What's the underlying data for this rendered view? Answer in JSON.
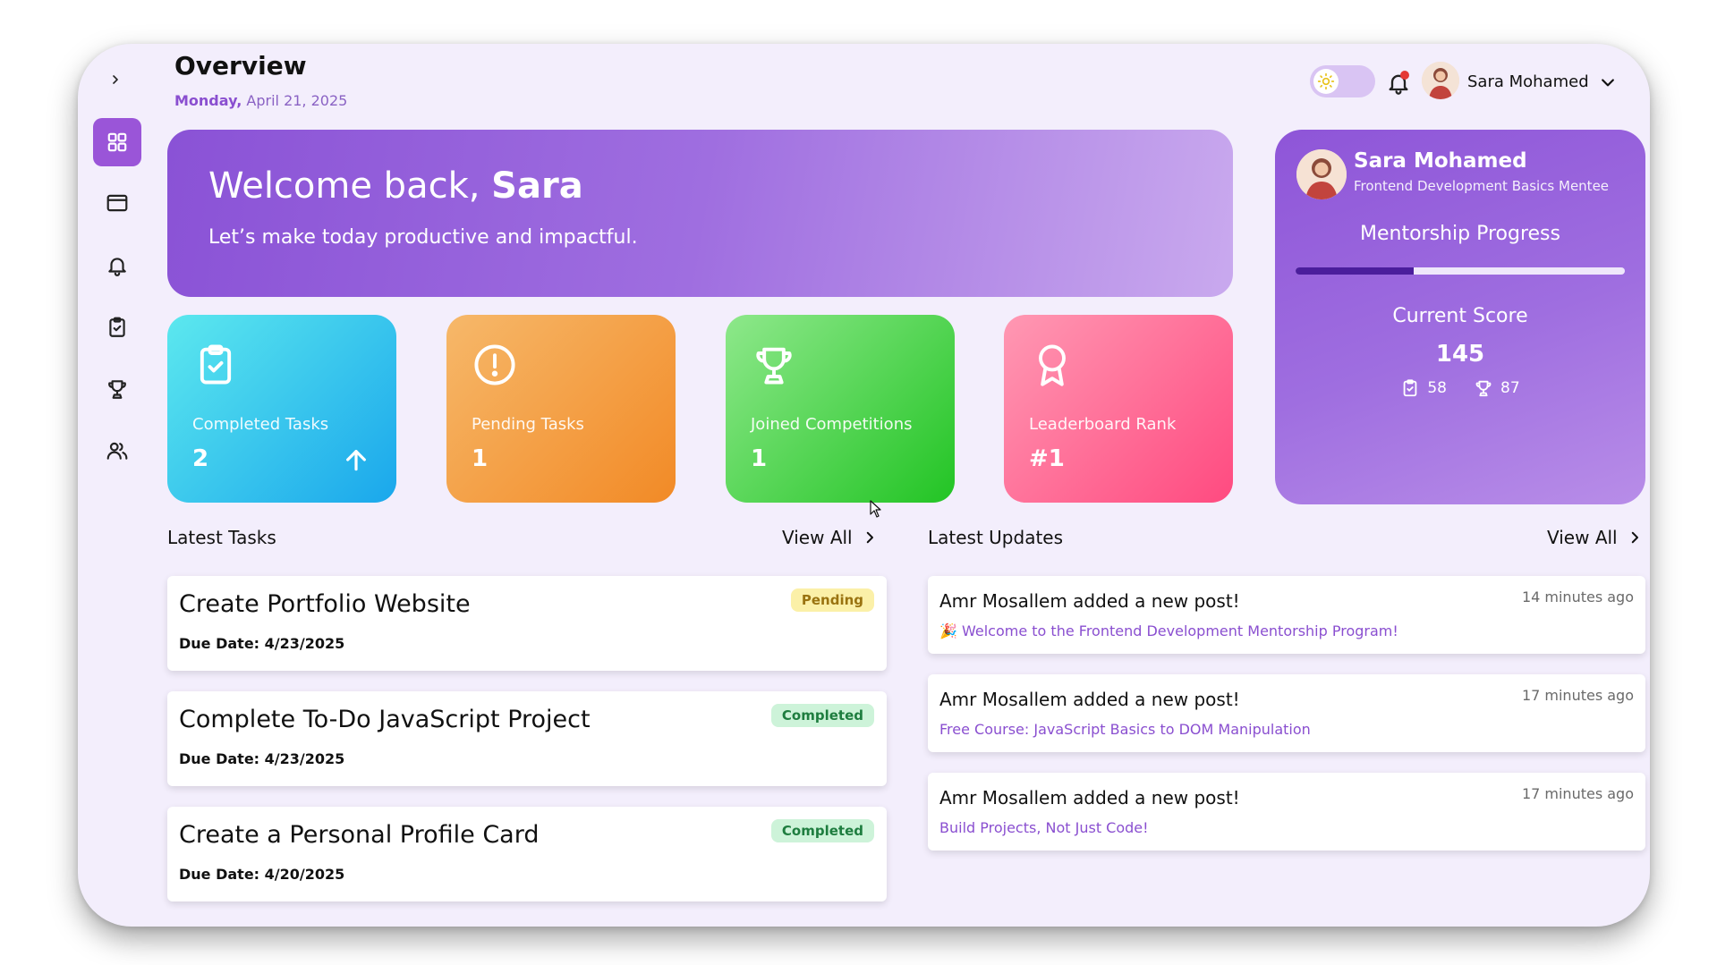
{
  "header": {
    "title": "Overview",
    "date_weekday": "Monday,",
    "date_rest": " April 21, 2025",
    "user_name": "Sara Mohamed"
  },
  "sidebar": {
    "items": [
      {
        "name": "dashboard",
        "icon": "grid-icon",
        "active": true
      },
      {
        "name": "browser",
        "icon": "window-icon",
        "active": false
      },
      {
        "name": "notifications",
        "icon": "bell-icon",
        "active": false
      },
      {
        "name": "tasks",
        "icon": "clipboard-check-icon",
        "active": false
      },
      {
        "name": "competitions",
        "icon": "trophy-icon",
        "active": false
      },
      {
        "name": "community",
        "icon": "users-icon",
        "active": false
      }
    ]
  },
  "hero": {
    "greeting": "Welcome back, ",
    "name": "Sara",
    "subtitle": "Let’s make today productive and impactful."
  },
  "stats": [
    {
      "label": "Completed Tasks",
      "value": "2",
      "icon": "clipboard-check-icon",
      "color_from": "#5ce8ee",
      "color_to": "#1aa7ec"
    },
    {
      "label": "Pending Tasks",
      "value": "1",
      "icon": "alert-circle-icon",
      "color_from": "#f6b86a",
      "color_to": "#f28a26"
    },
    {
      "label": "Joined Competitions",
      "value": "1",
      "icon": "trophy-icon",
      "color_from": "#8ee88b",
      "color_to": "#22c424"
    },
    {
      "label": "Leaderboard Rank",
      "value": "#1",
      "icon": "award-icon",
      "color_from": "#ff98b3",
      "color_to": "#ff4a80"
    }
  ],
  "profile": {
    "name": "Sara Mohamed",
    "role": "Frontend Development Basics Mentee",
    "progress_title": "Mentorship Progress",
    "progress_fraction": 0.36,
    "score_label": "Current Score",
    "score": "145",
    "tasks_points": "58",
    "competition_points": "87"
  },
  "tasks_section": {
    "title": "Latest Tasks",
    "view_all": "View All",
    "items": [
      {
        "title": "Create Portfolio Website",
        "due_label": "Due Date:",
        "due": "4/23/2025",
        "status": "Pending"
      },
      {
        "title": "Complete To-Do JavaScript Project",
        "due_label": "Due Date:",
        "due": "4/23/2025",
        "status": "Completed"
      },
      {
        "title": "Create a Personal Profile Card",
        "due_label": "Due Date:",
        "due": "4/20/2025",
        "status": "Completed"
      }
    ]
  },
  "updates_section": {
    "title": "Latest Updates",
    "view_all": "View All",
    "items": [
      {
        "title": "Amr Mosallem added a new post!",
        "text": "🎉 Welcome to the Frontend Development Mentorship Program!",
        "time": "14 minutes ago"
      },
      {
        "title": "Amr Mosallem added a new post!",
        "text": "Free Course: JavaScript Basics to DOM Manipulation",
        "time": "17 minutes ago"
      },
      {
        "title": "Amr Mosallem added a new post!",
        "text": "Build Projects, Not Just Code!",
        "time": "17 minutes ago"
      }
    ]
  },
  "colors": {
    "accent": "#9a55d8",
    "background": "#f3eefc",
    "pending_badge": "#fbf0a8",
    "completed_badge": "#cdf3d9"
  }
}
